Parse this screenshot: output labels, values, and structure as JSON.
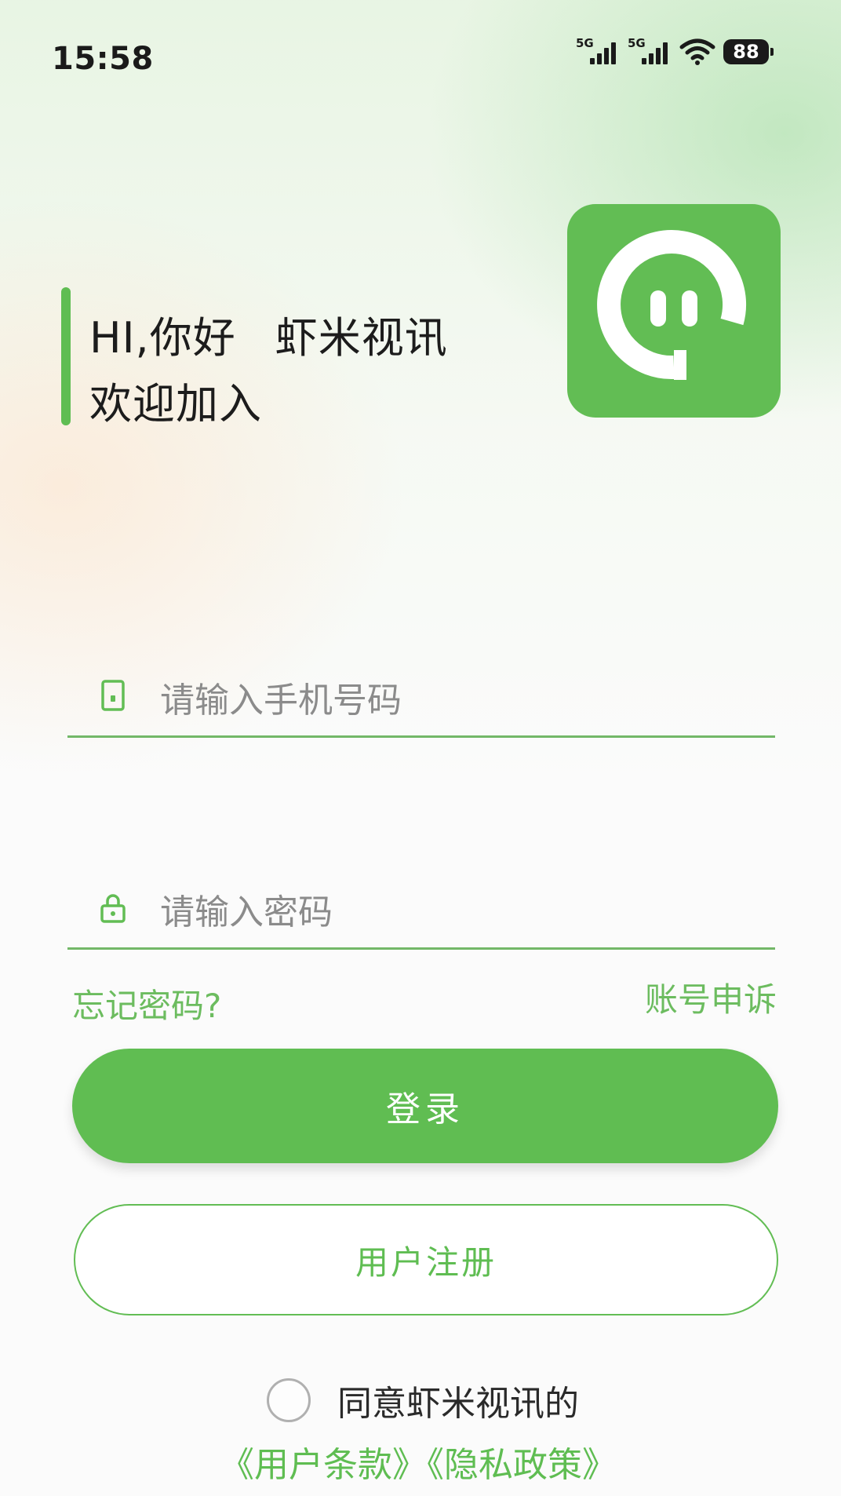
{
  "status_bar": {
    "time": "15:58",
    "signal_1_label": "5G",
    "signal_2_label": "5G",
    "battery_level": "88",
    "icons": [
      "signal-5g-icon",
      "signal-5g-icon",
      "wifi-icon",
      "battery-icon"
    ]
  },
  "greeting": {
    "hi": "HI,你好",
    "app_name": "虾米视讯",
    "welcome": "欢迎加入"
  },
  "logo": {
    "icon": "chat-bubble-logo-icon",
    "color": "#62bd54"
  },
  "form": {
    "phone_placeholder": "请输入手机号码",
    "phone_icon": "phone-icon",
    "password_placeholder": "请输入密码",
    "password_icon": "lock-icon"
  },
  "links": {
    "forgot_password": "忘记密码?",
    "account_appeal": "账号申诉"
  },
  "buttons": {
    "login": "登录",
    "register": "用户注册"
  },
  "agreement": {
    "checked": false,
    "text": "同意虾米视讯的",
    "policies": "《用户条款》《隐私政策》"
  },
  "colors": {
    "accent": "#62bd54",
    "link": "#6cbc5f",
    "placeholder": "#8b8b8b"
  }
}
